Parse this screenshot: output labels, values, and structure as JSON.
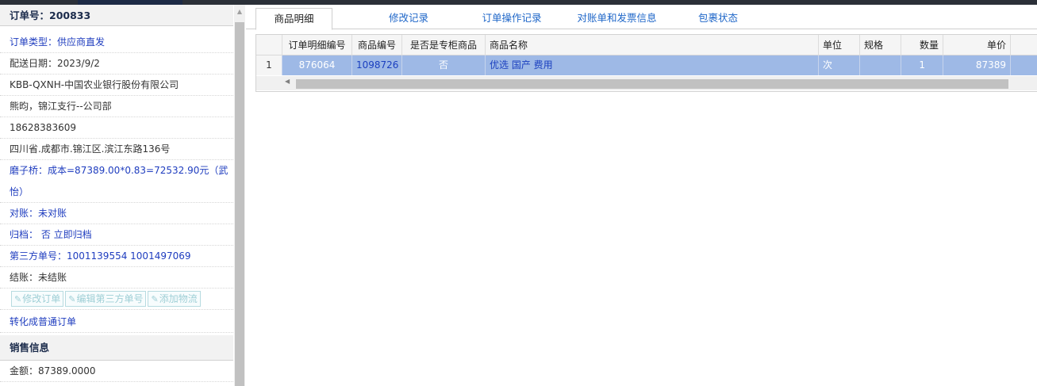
{
  "left": {
    "order_no": "订单号：200833",
    "order_type": "订单类型：供应商直发",
    "ship_date": "配送日期：2023/9/2",
    "company": "KBB-QXNH-中国农业银行股份有限公司",
    "contact": "熊昀，锦江支行--公司部",
    "phone": "18628383609",
    "address": "四川省.成都市.锦江区.滨江东路136号",
    "cost_note": "磨子桥：成本=87389.00*0.83=72532.90元（武怡）",
    "reconcile": "对账：未对账",
    "archive": "归档： 否 立即归档",
    "third_party": "第三方单号：1001139554 1001497069",
    "settle": "结账：未结账",
    "buttons": {
      "edit_order": "修改订单",
      "edit_third": "编辑第三方单号",
      "add_logistics": "添加物流"
    },
    "convert": "转化成普通订单",
    "sales_header": "销售信息",
    "amount": "金额：87389.0000"
  },
  "tabs": [
    "商品明细",
    "修改记录",
    "订单操作记录",
    "对账单和发票信息",
    "包裹状态"
  ],
  "table": {
    "columns": [
      "订单明细编号",
      "商品编号",
      "是否是专柜商品",
      "商品名称",
      "单位",
      "规格",
      "数量",
      "单价"
    ],
    "rows": [
      {
        "index": "1",
        "detail_no": "876064",
        "product_no": "1098726",
        "is_counter": "否",
        "name": "优选 国产 费用",
        "unit": "次",
        "spec": "",
        "qty": "1",
        "price": "87389"
      }
    ]
  }
}
